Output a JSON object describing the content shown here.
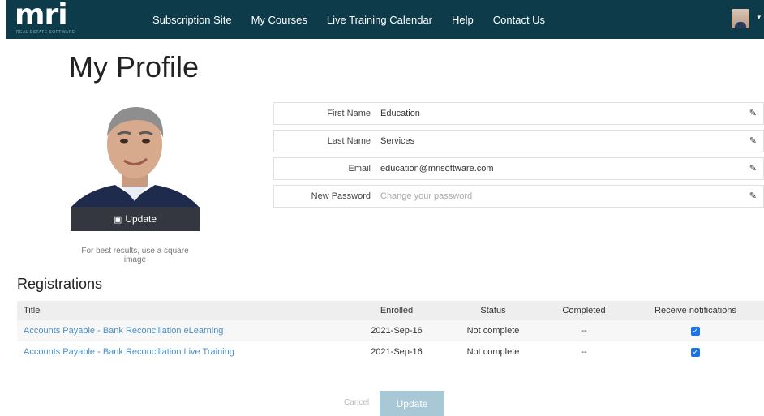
{
  "nav": {
    "logo_text": "mri",
    "logo_subtext": "REAL ESTATE SOFTWARE",
    "links": [
      "Subscription Site",
      "My Courses",
      "Live Training Calendar",
      "Help",
      "Contact Us"
    ],
    "caret": "▾"
  },
  "page": {
    "title": "My Profile"
  },
  "photo": {
    "update_label": "Update",
    "hint": "For best results, use a square image"
  },
  "fields": [
    {
      "label": "First Name",
      "value": "Education",
      "placeholder": ""
    },
    {
      "label": "Last Name",
      "value": "Services",
      "placeholder": ""
    },
    {
      "label": "Email",
      "value": "education@mrisoftware.com",
      "placeholder": ""
    },
    {
      "label": "New Password",
      "value": "",
      "placeholder": "Change your password"
    }
  ],
  "registrations": {
    "title": "Registrations",
    "columns": [
      "Title",
      "Enrolled",
      "Status",
      "Completed",
      "Receive notifications"
    ],
    "rows": [
      {
        "title": "Accounts Payable - Bank Reconciliation eLearning",
        "enrolled": "2021-Sep-16",
        "status": "Not complete",
        "completed": "--",
        "notify": true
      },
      {
        "title": "Accounts Payable - Bank Reconciliation Live Training",
        "enrolled": "2021-Sep-16",
        "status": "Not complete",
        "completed": "--",
        "notify": true
      }
    ]
  },
  "actions": {
    "cancel_label": "Cancel",
    "update_label": "Update"
  },
  "colors": {
    "navbar": "#0d3b4a",
    "link": "#4a90c6",
    "update_button": "#a9c8d6"
  },
  "icons": {
    "edit": "pencil-icon",
    "camera": "camera-icon",
    "checkbox": "checkbox-checked-icon"
  }
}
